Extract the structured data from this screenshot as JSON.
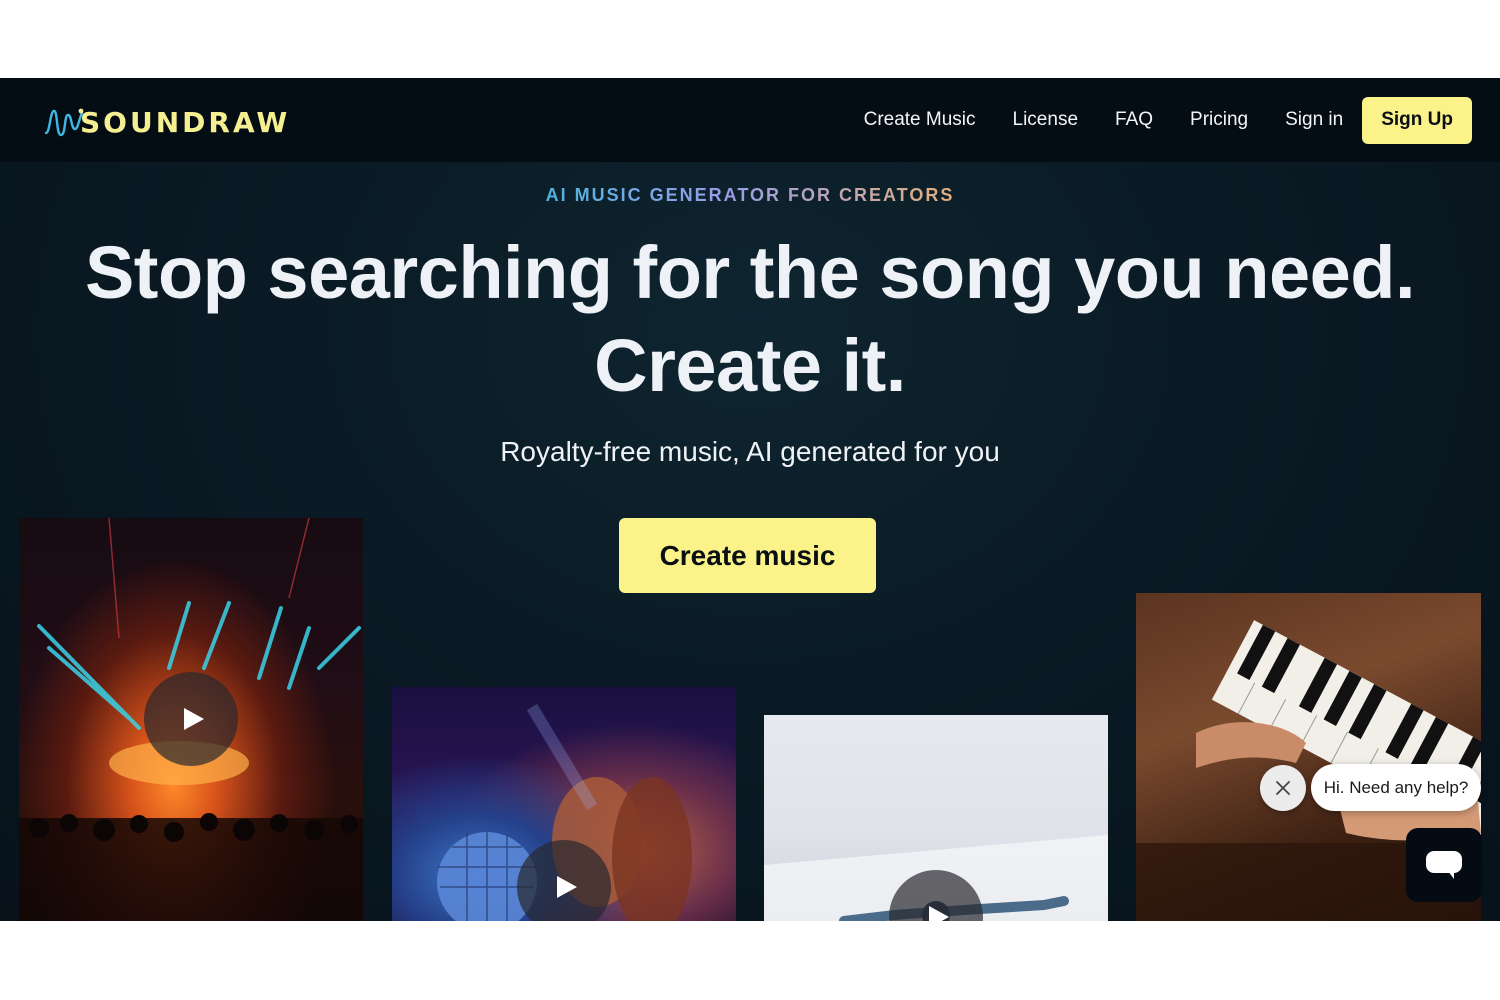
{
  "brand": {
    "name": "SOUNDRAW",
    "logo_color": "#f6ef92"
  },
  "nav": {
    "links": [
      "Create Music",
      "License",
      "FAQ",
      "Pricing",
      "Sign in"
    ],
    "signup_label": "Sign Up"
  },
  "hero": {
    "eyebrow": "AI MUSIC GENERATOR FOR CREATORS",
    "headline_line1": "Stop searching for the song you need.",
    "headline_line2": "Create it.",
    "subhead": "Royalty-free music, AI generated for you",
    "cta_label": "Create music"
  },
  "cards": [
    {
      "name": "concert-lights-video",
      "icon": "play-icon"
    },
    {
      "name": "disco-ball-video",
      "icon": "play-icon"
    },
    {
      "name": "dancer-video",
      "icon": "play-icon"
    },
    {
      "name": "piano-video",
      "icon": "play-icon"
    }
  ],
  "chat": {
    "greeting": "Hi. Need any help?",
    "close_icon": "close-icon",
    "launcher_icon": "chat-icon"
  },
  "colors": {
    "accent": "#fbf38a",
    "nav_bg": "#050d14",
    "hero_bg": "#0a1a24",
    "text": "#eef2f7"
  }
}
